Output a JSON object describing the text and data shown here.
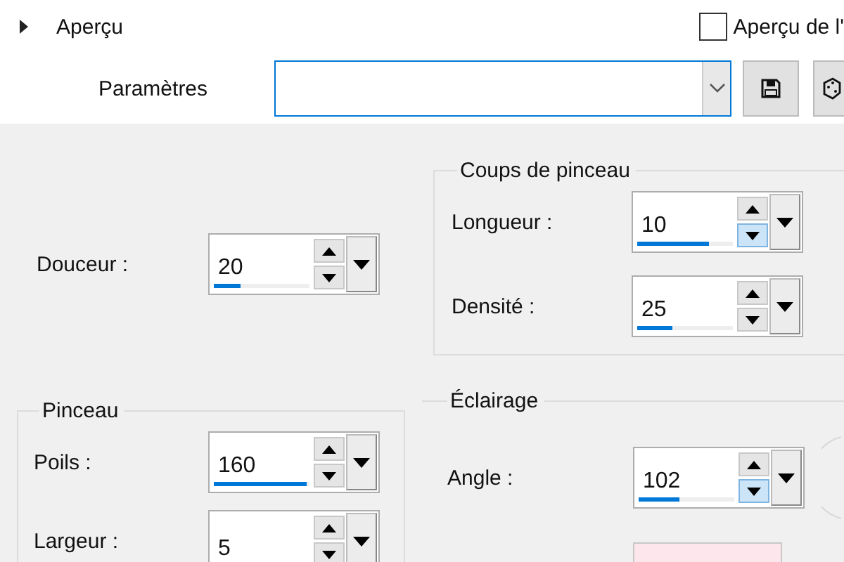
{
  "preview": {
    "label": "Aperçu",
    "expanded": false
  },
  "preview_checkbox": {
    "label": "Aperçu de l'",
    "checked": false
  },
  "settings": {
    "label": "Paramètres"
  },
  "softness": {
    "fields": [
      {
        "label": "Douceur :",
        "value": "20",
        "level": 0.28,
        "down_hover": false
      }
    ]
  },
  "brush": {
    "title": "Pinceau",
    "fields": [
      {
        "label": "Poils :",
        "value": "160",
        "level": 0.97,
        "down_hover": false
      },
      {
        "label": "Largeur :",
        "value": "5",
        "down_hover": false
      }
    ]
  },
  "strokes": {
    "title": "Coups de pinceau",
    "fields": [
      {
        "label": "Longueur :",
        "value": "10",
        "level": 0.75,
        "down_hover": true
      },
      {
        "label": "Densité :",
        "value": "25",
        "level": 0.37,
        "down_hover": false
      }
    ]
  },
  "lighting": {
    "title": "Éclairage",
    "fields": [
      {
        "label": "Angle :",
        "value": "102",
        "level": 0.42,
        "down_hover": true
      }
    ],
    "swatch": {
      "color": "#fde6ec"
    }
  }
}
